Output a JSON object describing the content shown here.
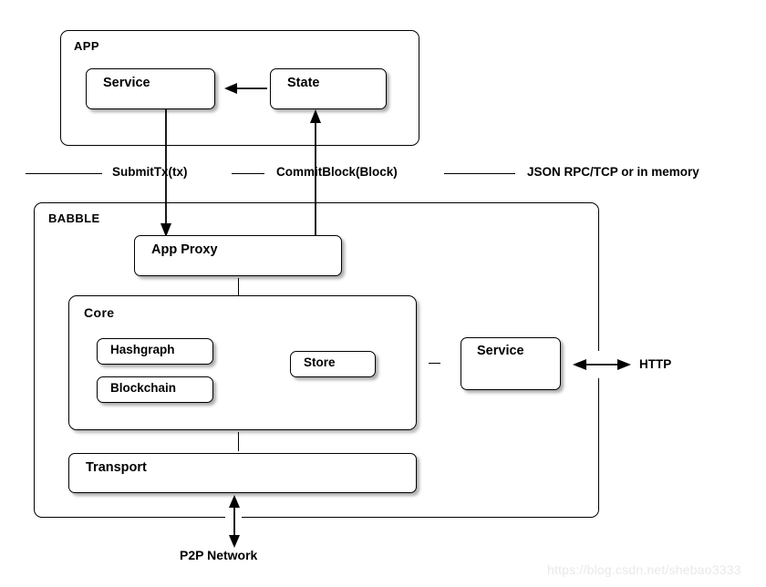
{
  "diagram": {
    "title_app": "APP",
    "title_babble": "BABBLE",
    "groups": {
      "app": {
        "label": "APP"
      },
      "babble": {
        "label": "BABBLE"
      },
      "core": {
        "label": "Core"
      }
    },
    "nodes": {
      "service_app": {
        "label": "Service"
      },
      "state": {
        "label": "State"
      },
      "app_proxy": {
        "label": "App Proxy"
      },
      "hashgraph": {
        "label": "Hashgraph"
      },
      "blockchain": {
        "label": "Blockchain"
      },
      "store": {
        "label": "Store"
      },
      "service_babble": {
        "label": "Service"
      },
      "transport": {
        "label": "Transport"
      }
    },
    "boundary_labels": {
      "submit_tx": "SubmitTx(tx)",
      "commit_block": "CommitBlock(Block)",
      "protocol": "JSON RPC/TCP or in memory"
    },
    "edge_labels": {
      "http": "HTTP",
      "p2p": "P2P Network"
    },
    "watermark": "https://blog.csdn.net/shebao3333",
    "colors": {
      "stroke": "#000000",
      "background": "#ffffff",
      "watermark": "#e9e9e9"
    }
  }
}
